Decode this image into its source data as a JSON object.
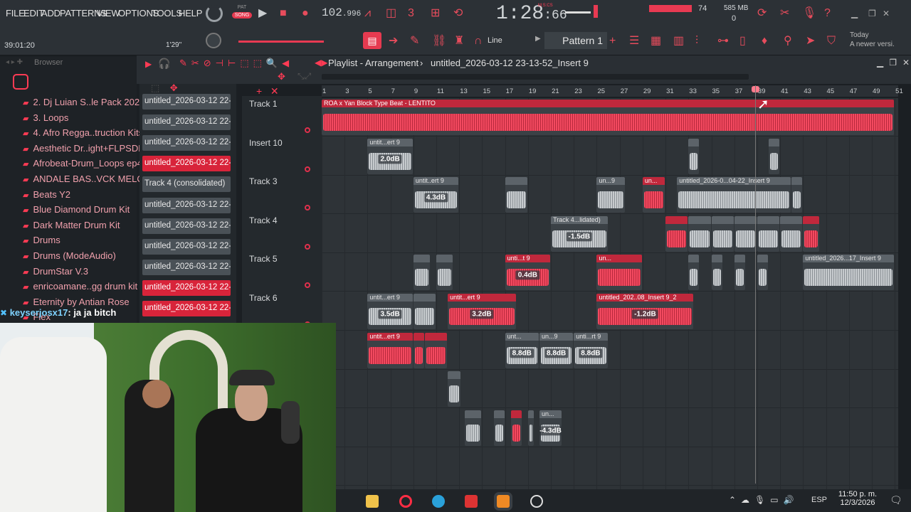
{
  "menu": [
    "FILE",
    "EDIT",
    "ADD",
    "PATTERNS",
    "VIEW",
    "OPTIONS",
    "TOOLS",
    "HELP"
  ],
  "transport": {
    "pat_label": "PAT",
    "song_label": "SONG",
    "tempo": "102",
    "tempo_frac": ".996",
    "time": "1:28",
    "time_ms": ":66",
    "time_unit": "M:S:CS",
    "cpu": "74",
    "ram": "585 MB",
    "ram_sub": "0",
    "hint_time": "39:01:20",
    "hint_pos": "1'29\""
  },
  "toolbar": {
    "line_label": "Line",
    "pattern_label": "Pattern 1",
    "news_title": "Today",
    "news_sub": "A newer versi..."
  },
  "playlist": {
    "title": "Playlist - Arrangement",
    "project": "untitled_2026-03-12 23-13-52_Insert 9",
    "browser_label": "Browser"
  },
  "browser": {
    "items": [
      "2. Dj Luian S..le Pack 2020",
      "3. Loops",
      "4. Afro Regga..truction Kits",
      "Aesthetic Dr..ight+FLPSDE)",
      "Afrobeat-Drum_Loops ep4",
      "ANDALE BAS..VCK MELODY",
      "Beats Y2",
      "Blue Diamond Drum Kit",
      "Dark Matter Drum Kit",
      "Drums",
      "Drums (ModeAudio)",
      "DrumStar V.3",
      "enricoamane..gg drum kit",
      "Eternity by Antian Rose",
      "Flex"
    ]
  },
  "chat": {
    "user": "keyserjosx17",
    "text": ": ja ja bitch"
  },
  "patterns": [
    {
      "label": "untitled_2026-03-12 22-...",
      "sel": false
    },
    {
      "label": "untitled_2026-03-12 22-...",
      "sel": false
    },
    {
      "label": "untitled_2026-03-12 22-...",
      "sel": false
    },
    {
      "label": "untitled_2026-03-12 22-...",
      "sel": true
    },
    {
      "label": "Track 4 (consolidated)",
      "sel": false
    },
    {
      "label": "untitled_2026-03-12 22-...",
      "sel": false
    },
    {
      "label": "untitled_2026-03-12 22-...",
      "sel": false
    },
    {
      "label": "untitled_2026-03-12 22-...",
      "sel": false
    },
    {
      "label": "untitled_2026-03-12 22-...",
      "sel": false
    },
    {
      "label": "untitled_2026-03-12 22-...",
      "sel": true
    },
    {
      "label": "untitled_2026-03-12 22-...",
      "sel": true
    }
  ],
  "tracks": [
    "Track 1",
    "Insert 10",
    "Track 3",
    "Track 4",
    "Track 5",
    "Track 6"
  ],
  "ruler": [
    "1",
    "3",
    "5",
    "7",
    "9",
    "11",
    "13",
    "15",
    "17",
    "19",
    "21",
    "23",
    "25",
    "27",
    "29",
    "31",
    "33",
    "35",
    "37",
    "39",
    "41",
    "43",
    "45",
    "47",
    "49",
    "51"
  ],
  "clips": [
    {
      "lane": 0,
      "s": 1,
      "e": 51,
      "c": "r",
      "t": "ROA x Yan Block Type Beat - LENTITO",
      "db": ""
    },
    {
      "lane": 1,
      "s": 5,
      "e": 9,
      "c": "g",
      "t": "untit...ert 9",
      "db": "2.0dB"
    },
    {
      "lane": 1,
      "s": 33,
      "e": 34,
      "c": "g",
      "t": "",
      "db": ""
    },
    {
      "lane": 1,
      "s": 40,
      "e": 41,
      "c": "g",
      "t": "",
      "db": ""
    },
    {
      "lane": 2,
      "s": 9,
      "e": 13,
      "c": "g",
      "t": "untit..ert 9",
      "db": "4.3dB"
    },
    {
      "lane": 2,
      "s": 17,
      "e": 19,
      "c": "g",
      "t": "",
      "db": ""
    },
    {
      "lane": 2,
      "s": 25,
      "e": 27.5,
      "c": "g",
      "t": "un...9",
      "db": ""
    },
    {
      "lane": 2,
      "s": 29,
      "e": 31,
      "c": "r",
      "t": "un...",
      "db": ""
    },
    {
      "lane": 2,
      "s": 32,
      "e": 42,
      "c": "g",
      "t": "untitled_2026-0...04-22_Insert 9",
      "db": ""
    },
    {
      "lane": 2,
      "s": 42,
      "e": 43,
      "c": "g",
      "t": "",
      "db": ""
    },
    {
      "lane": 3,
      "s": 21,
      "e": 26,
      "c": "g",
      "t": "Track 4...lidated)",
      "db": "-1.5dB"
    },
    {
      "lane": 3,
      "s": 31,
      "e": 33,
      "c": "r",
      "t": "",
      "db": ""
    },
    {
      "lane": 3,
      "s": 33,
      "e": 35,
      "c": "g",
      "t": "",
      "db": ""
    },
    {
      "lane": 3,
      "s": 35,
      "e": 37,
      "c": "g",
      "t": "",
      "db": ""
    },
    {
      "lane": 3,
      "s": 37,
      "e": 39,
      "c": "g",
      "t": "",
      "db": ""
    },
    {
      "lane": 3,
      "s": 39,
      "e": 41,
      "c": "g",
      "t": "",
      "db": ""
    },
    {
      "lane": 3,
      "s": 41,
      "e": 43,
      "c": "g",
      "t": "",
      "db": ""
    },
    {
      "lane": 3,
      "s": 43,
      "e": 44.5,
      "c": "r",
      "t": "",
      "db": ""
    },
    {
      "lane": 4,
      "s": 9,
      "e": 10.5,
      "c": "g",
      "t": "",
      "db": ""
    },
    {
      "lane": 4,
      "s": 11,
      "e": 12.5,
      "c": "g",
      "t": "",
      "db": ""
    },
    {
      "lane": 4,
      "s": 17,
      "e": 21,
      "c": "r",
      "t": "unti...t 9",
      "db": "0.4dB"
    },
    {
      "lane": 4,
      "s": 25,
      "e": 29,
      "c": "r",
      "t": "un...",
      "db": ""
    },
    {
      "lane": 4,
      "s": 33,
      "e": 34,
      "c": "g",
      "t": "",
      "db": ""
    },
    {
      "lane": 4,
      "s": 35,
      "e": 36,
      "c": "g",
      "t": "",
      "db": ""
    },
    {
      "lane": 4,
      "s": 37,
      "e": 38,
      "c": "g",
      "t": "",
      "db": ""
    },
    {
      "lane": 4,
      "s": 39,
      "e": 40,
      "c": "g",
      "t": "",
      "db": ""
    },
    {
      "lane": 4,
      "s": 43,
      "e": 51,
      "c": "g",
      "t": "untitled_2026...17_Insert 9",
      "db": ""
    },
    {
      "lane": 5,
      "s": 5,
      "e": 9,
      "c": "g",
      "t": "untit...ert 9",
      "db": "3.5dB"
    },
    {
      "lane": 5,
      "s": 9,
      "e": 11,
      "c": "g",
      "t": "",
      "db": ""
    },
    {
      "lane": 5,
      "s": 12,
      "e": 18,
      "c": "r",
      "t": "untit...ert 9",
      "db": "3.2dB"
    },
    {
      "lane": 5,
      "s": 25,
      "e": 33.5,
      "c": "r",
      "t": "untitled_202..08_Insert 9_2",
      "db": "-1.2dB"
    },
    {
      "lane": 6,
      "s": 5,
      "e": 9,
      "c": "r",
      "t": "untit...ert 9",
      "db": ""
    },
    {
      "lane": 6,
      "s": 9,
      "e": 10,
      "c": "r",
      "t": "",
      "db": ""
    },
    {
      "lane": 6,
      "s": 10,
      "e": 12,
      "c": "r",
      "t": "",
      "db": ""
    },
    {
      "lane": 6,
      "s": 17,
      "e": 20,
      "c": "g",
      "t": "unt...",
      "db": "8.8dB"
    },
    {
      "lane": 6,
      "s": 20,
      "e": 23,
      "c": "g",
      "t": "un...9",
      "db": "8.8dB"
    },
    {
      "lane": 6,
      "s": 23,
      "e": 26,
      "c": "g",
      "t": "unti...rt 9",
      "db": "8.8dB"
    },
    {
      "lane": 7,
      "s": 12,
      "e": 13.2,
      "c": "g",
      "t": "",
      "db": ""
    },
    {
      "lane": 8,
      "s": 13.5,
      "e": 15,
      "c": "g",
      "t": "",
      "db": ""
    },
    {
      "lane": 8,
      "s": 16,
      "e": 17,
      "c": "g",
      "t": "",
      "db": ""
    },
    {
      "lane": 8,
      "s": 17.5,
      "e": 18.5,
      "c": "r",
      "t": "",
      "db": ""
    },
    {
      "lane": 8,
      "s": 19,
      "e": 19.5,
      "c": "g",
      "t": "",
      "db": ""
    },
    {
      "lane": 8,
      "s": 20,
      "e": 22,
      "c": "g",
      "t": "un...",
      "db": "-4.3dB"
    }
  ],
  "taskbar": {
    "lang": "ESP",
    "time": "11:50 p. m.",
    "date": "12/3/2026"
  },
  "colors": {
    "accent": "#ff3b54",
    "clip_red": "#e83a52",
    "clip_grey": "#c3c7ca"
  }
}
